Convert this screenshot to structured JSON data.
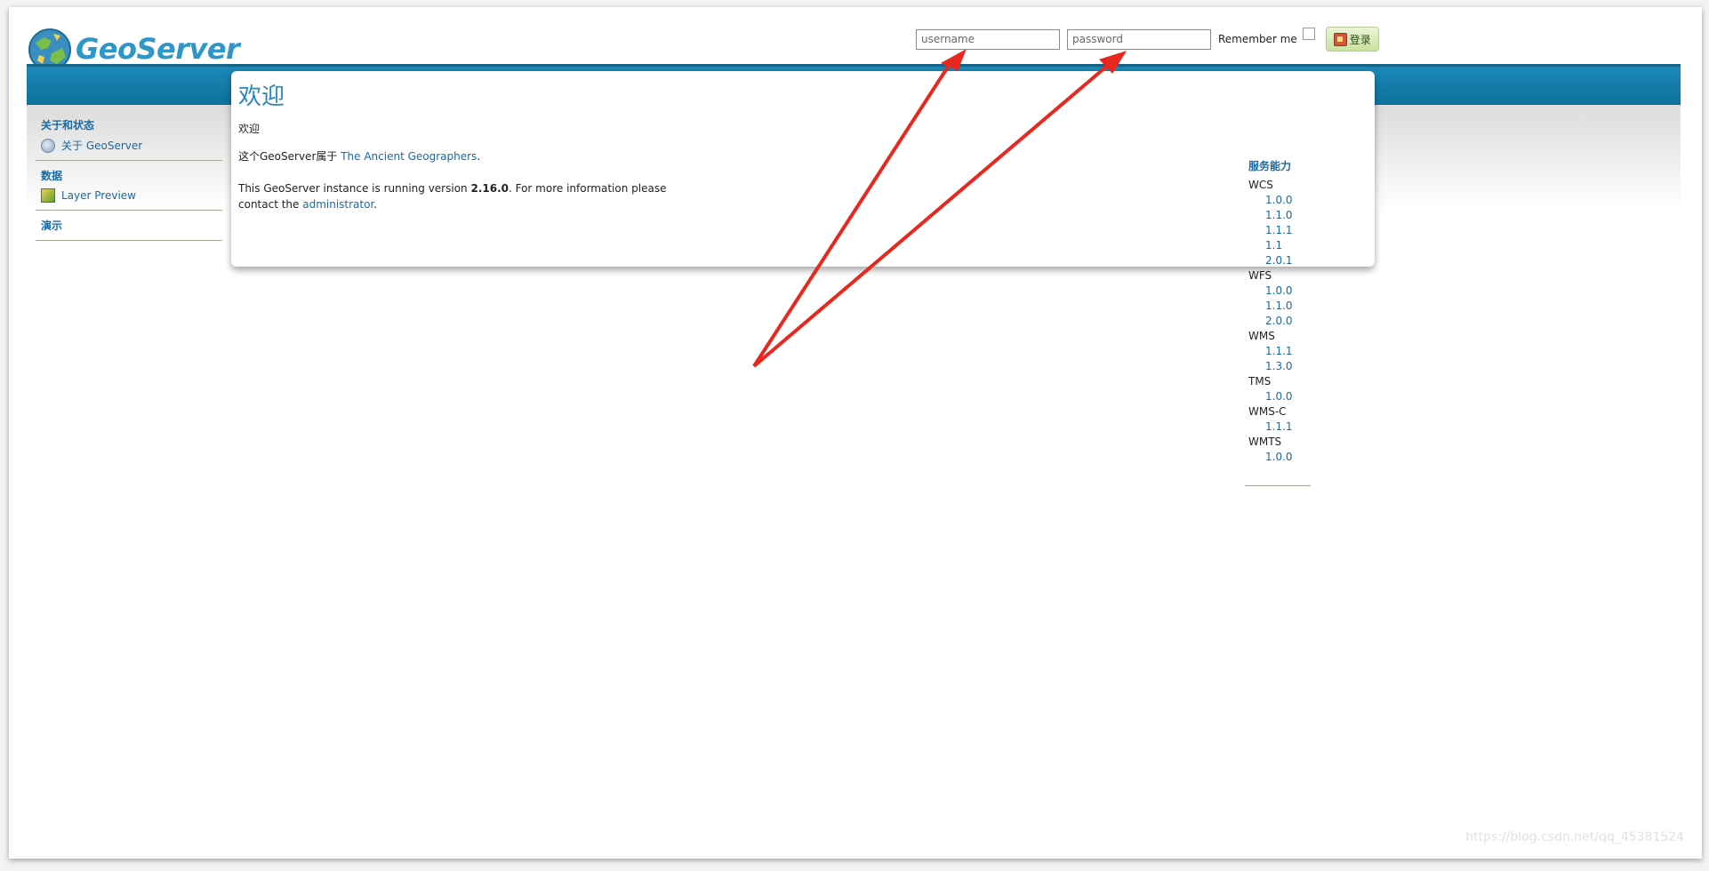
{
  "brand": {
    "name": "GeoServer"
  },
  "login": {
    "username_placeholder": "username",
    "password_placeholder": "password",
    "remember_label": "Remember me",
    "button_label": "登录"
  },
  "sidebar": {
    "sections": [
      {
        "title": "关于和状态",
        "items": [
          {
            "label": "关于 GeoServer",
            "icon": "globe-help-icon"
          }
        ]
      },
      {
        "title": "数据",
        "items": [
          {
            "label": "Layer Preview",
            "icon": "layer-preview-icon"
          }
        ]
      },
      {
        "title": "演示",
        "items": []
      }
    ]
  },
  "content": {
    "title": "欢迎",
    "subtitle": "欢迎",
    "owner_prefix": "这个GeoServer属于 ",
    "owner_link": "The Ancient Geographers",
    "owner_suffix": ".",
    "version_prefix": "This GeoServer instance is running version ",
    "version": "2.16.0",
    "version_middle": ". For more information please contact the ",
    "admin_link": "administrator",
    "version_suffix": "."
  },
  "capabilities": {
    "title": "服务能力",
    "services": [
      {
        "name": "WCS",
        "versions": [
          "1.0.0",
          "1.1.0",
          "1.1.1",
          "1.1",
          "2.0.1"
        ]
      },
      {
        "name": "WFS",
        "versions": [
          "1.0.0",
          "1.1.0",
          "2.0.0"
        ]
      },
      {
        "name": "WMS",
        "versions": [
          "1.1.1",
          "1.3.0"
        ]
      },
      {
        "name": "TMS",
        "versions": [
          "1.0.0"
        ]
      },
      {
        "name": "WMS-C",
        "versions": [
          "1.1.1"
        ]
      },
      {
        "name": "WMTS",
        "versions": [
          "1.0.0"
        ]
      }
    ]
  },
  "colors": {
    "header_band": "#0d6f9d",
    "link": "#1a6aa0",
    "arrow": "#e8281f"
  },
  "watermark": "https://blog.csdn.net/qq_45381524"
}
